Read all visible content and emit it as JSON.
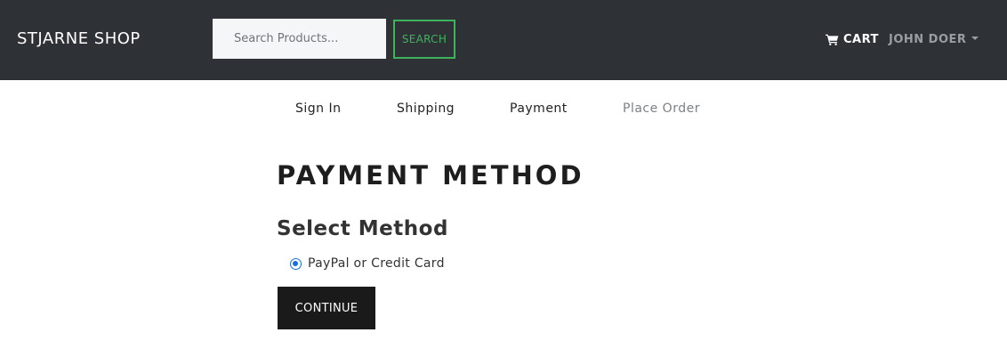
{
  "header": {
    "brand": "STJARNE SHOP",
    "search": {
      "placeholder": "Search Products...",
      "value": "",
      "button_label": "SEARCH"
    },
    "cart_label": "CART",
    "cart_icon": "shopping-cart-icon",
    "user_name": "JOHN DOER",
    "colors": {
      "background": "#2e3237",
      "search_accent": "#3fb25c"
    }
  },
  "checkout_steps": [
    {
      "label": "Sign In",
      "enabled": true
    },
    {
      "label": "Shipping",
      "enabled": true
    },
    {
      "label": "Payment",
      "enabled": true
    },
    {
      "label": "Place Order",
      "enabled": false
    }
  ],
  "main": {
    "title": "PAYMENT METHOD",
    "section_title": "Select Method",
    "payment_options": [
      {
        "label": "PayPal or Credit Card",
        "selected": true
      }
    ],
    "continue_label": "CONTINUE"
  }
}
